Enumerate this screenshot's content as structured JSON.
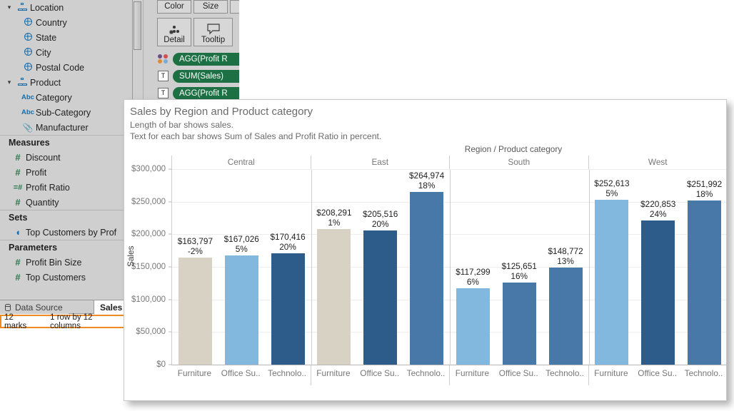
{
  "app": {
    "data_pane": {
      "groups": [
        {
          "type": "hierarchy",
          "label": "Location",
          "icon": "hierarchy-icon",
          "expanded": true,
          "children": [
            {
              "label": "Country",
              "icon": "globe-icon"
            },
            {
              "label": "State",
              "icon": "globe-icon"
            },
            {
              "label": "City",
              "icon": "globe-icon"
            },
            {
              "label": "Postal Code",
              "icon": "globe-icon"
            }
          ]
        },
        {
          "type": "hierarchy",
          "label": "Product",
          "icon": "hierarchy-icon",
          "expanded": true,
          "children": [
            {
              "label": "Category",
              "icon": "abc-icon"
            },
            {
              "label": "Sub-Category",
              "icon": "abc-icon"
            },
            {
              "label": "Manufacturer",
              "icon": "paperclip-icon"
            }
          ]
        }
      ],
      "sections": [
        {
          "title": "Measures",
          "items": [
            {
              "label": "Discount",
              "icon": "number-icon"
            },
            {
              "label": "Profit",
              "icon": "number-icon"
            },
            {
              "label": "Profit Ratio",
              "icon": "calculated-number-icon"
            },
            {
              "label": "Quantity",
              "icon": "number-icon"
            }
          ]
        },
        {
          "title": "Sets",
          "items": [
            {
              "label": "Top Customers by Prof",
              "icon": "set-icon"
            }
          ]
        },
        {
          "title": "Parameters",
          "items": [
            {
              "label": "Profit Bin Size",
              "icon": "number-icon"
            },
            {
              "label": "Top Customers",
              "icon": "number-icon"
            }
          ]
        }
      ]
    },
    "marks_card": {
      "buttons": [
        {
          "label": "Color",
          "icon": "color-icon"
        },
        {
          "label": "Size",
          "icon": "size-icon"
        },
        {
          "label": "L",
          "icon": "label-icon"
        },
        {
          "label": "Detail",
          "icon": "detail-icon"
        },
        {
          "label": "Tooltip",
          "icon": "tooltip-icon"
        }
      ],
      "pills": [
        {
          "label": "AGG(Profit R",
          "shelf": "color",
          "icon": "color-swatches-icon"
        },
        {
          "label": "SUM(Sales)",
          "shelf": "text",
          "icon": "text-icon"
        },
        {
          "label": "AGG(Profit R",
          "shelf": "text",
          "icon": "text-icon"
        }
      ]
    },
    "tabs": {
      "data_source": "Data Source",
      "sheet": "Sales",
      "data_source_icon": "database-icon"
    },
    "status_bar": {
      "marks": "12 marks",
      "dimensions": "1 row by 12 columns",
      "highlight_color": "#f08a24"
    }
  },
  "viz": {
    "title": "Sales by Region and Product category",
    "subtitle_1": "Length of bar shows sales.",
    "subtitle_2": "Text for each bar shows Sum of Sales and Profit Ratio in percent."
  },
  "chart_data": {
    "type": "bar",
    "title": "Sales by Region and Product category",
    "subtitle": "Length of bar shows sales. Text for each bar shows Sum of Sales and Profit Ratio in percent.",
    "column_field_label": "Region / Product category",
    "xlabel": "",
    "ylabel": "Sales",
    "ylim": [
      0,
      300000
    ],
    "ytick_values": [
      0,
      50000,
      100000,
      150000,
      200000,
      250000,
      300000
    ],
    "ytick_labels": [
      "$0",
      "$50,000",
      "$100,000",
      "$150,000",
      "$200,000",
      "$250,000",
      "$300,000"
    ],
    "grid": true,
    "legend": null,
    "color_encoding": "Profit Ratio (AGG)",
    "palette": {
      "beige": "#d7d2c3",
      "light_blue": "#82b7de",
      "medium_blue": "#4778a8",
      "dark_blue": "#2d5c8a"
    },
    "groups": [
      {
        "region": "Central",
        "bars": [
          {
            "category": "Furniture",
            "category_short": "Furniture",
            "sales": 163797,
            "sales_label": "$163,797",
            "profit_ratio": -2,
            "profit_label": "-2%",
            "color": "#d7d2c3"
          },
          {
            "category": "Office Supplies",
            "category_short": "Office Su..",
            "sales": 167026,
            "sales_label": "$167,026",
            "profit_ratio": 5,
            "profit_label": "5%",
            "color": "#82b7de"
          },
          {
            "category": "Technology",
            "category_short": "Technolo..",
            "sales": 170416,
            "sales_label": "$170,416",
            "profit_ratio": 20,
            "profit_label": "20%",
            "color": "#2d5c8a"
          }
        ]
      },
      {
        "region": "East",
        "bars": [
          {
            "category": "Furniture",
            "category_short": "Furniture",
            "sales": 208291,
            "sales_label": "$208,291",
            "profit_ratio": 1,
            "profit_label": "1%",
            "color": "#d7d2c3"
          },
          {
            "category": "Office Supplies",
            "category_short": "Office Su..",
            "sales": 205516,
            "sales_label": "$205,516",
            "profit_ratio": 20,
            "profit_label": "20%",
            "color": "#2d5c8a"
          },
          {
            "category": "Technology",
            "category_short": "Technolo..",
            "sales": 264974,
            "sales_label": "$264,974",
            "profit_ratio": 18,
            "profit_label": "18%",
            "color": "#4778a8"
          }
        ]
      },
      {
        "region": "South",
        "bars": [
          {
            "category": "Furniture",
            "category_short": "Furniture",
            "sales": 117299,
            "sales_label": "$117,299",
            "profit_ratio": 6,
            "profit_label": "6%",
            "color": "#82b7de"
          },
          {
            "category": "Office Supplies",
            "category_short": "Office Su..",
            "sales": 125651,
            "sales_label": "$125,651",
            "profit_ratio": 16,
            "profit_label": "16%",
            "color": "#4778a8"
          },
          {
            "category": "Technology",
            "category_short": "Technolo..",
            "sales": 148772,
            "sales_label": "$148,772",
            "profit_ratio": 13,
            "profit_label": "13%",
            "color": "#4778a8"
          }
        ]
      },
      {
        "region": "West",
        "bars": [
          {
            "category": "Furniture",
            "category_short": "Furniture",
            "sales": 252613,
            "sales_label": "$252,613",
            "profit_ratio": 5,
            "profit_label": "5%",
            "color": "#82b7de"
          },
          {
            "category": "Office Supplies",
            "category_short": "Office Su..",
            "sales": 220853,
            "sales_label": "$220,853",
            "profit_ratio": 24,
            "profit_label": "24%",
            "color": "#2d5c8a"
          },
          {
            "category": "Technology",
            "category_short": "Technolo..",
            "sales": 251992,
            "sales_label": "$251,992",
            "profit_ratio": 18,
            "profit_label": "18%",
            "color": "#4778a8"
          }
        ]
      }
    ]
  }
}
